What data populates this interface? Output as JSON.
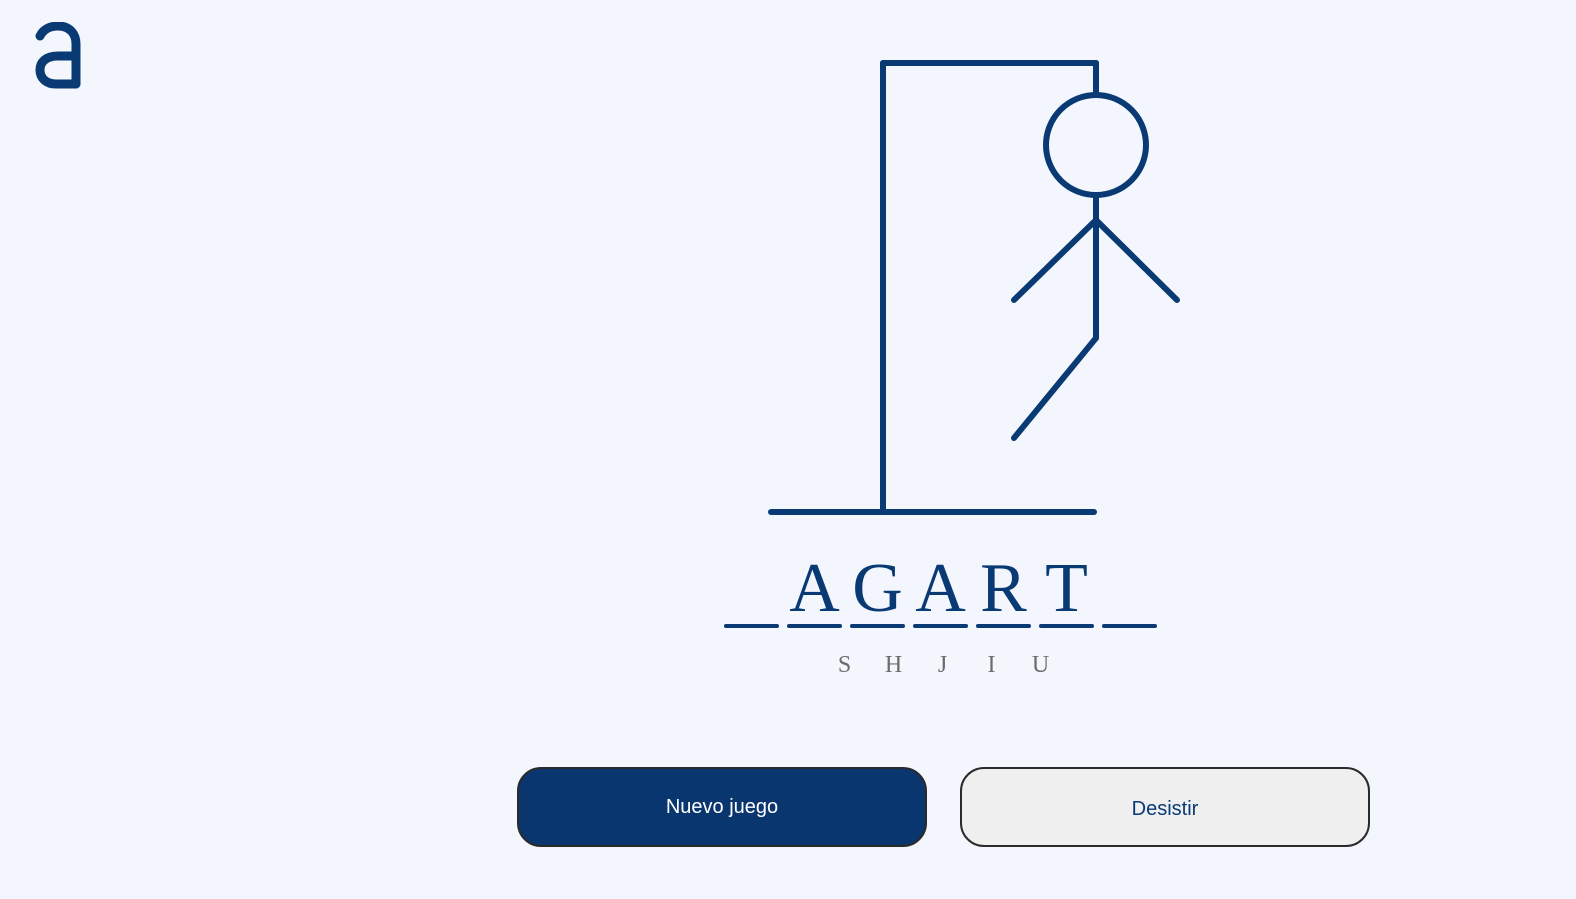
{
  "brand": {
    "logo_icon": "a-logo-icon",
    "color": "#0a3a73"
  },
  "game": {
    "slots": [
      "",
      "A",
      "G",
      "A",
      "R",
      "T",
      ""
    ],
    "wrong_letters": [
      "S",
      "H",
      "J",
      "I",
      "U"
    ],
    "hangman_parts_shown": [
      "head",
      "body",
      "left-arm",
      "right-arm",
      "left-leg"
    ]
  },
  "buttons": {
    "new_game": "Nuevo juego",
    "give_up": "Desistir"
  },
  "colors": {
    "background": "#f3f6fd",
    "primary": "#0a3670",
    "wrong_letter": "#6b6b6b",
    "secondary_button": "#efefef"
  }
}
